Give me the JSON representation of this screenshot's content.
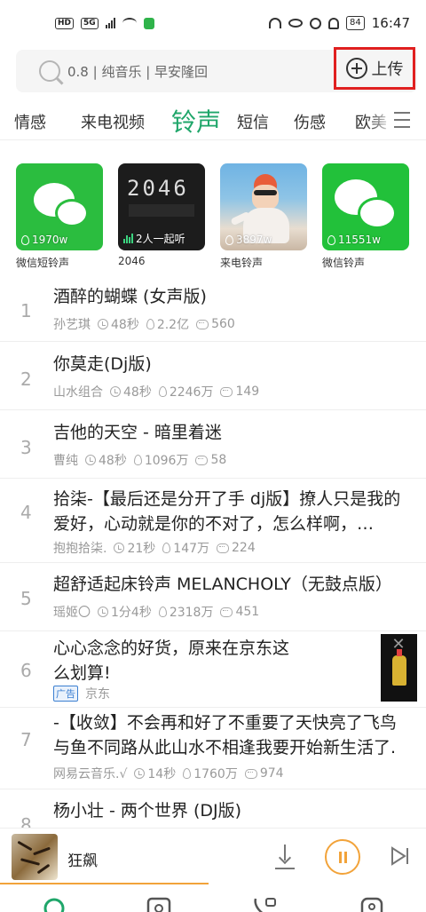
{
  "status_bar": {
    "left_chips": [
      "HD",
      "5G"
    ],
    "wifi_chip": "",
    "battery": "84",
    "time": "16:47"
  },
  "search": {
    "placeholder": "0.8 | 纯音乐 | 早安隆回",
    "upload_label": "上传"
  },
  "tabs": [
    {
      "label": "情感",
      "active": false
    },
    {
      "label": "来电视频",
      "active": false
    },
    {
      "label": "铃声",
      "active": true
    },
    {
      "label": "短信",
      "active": false
    },
    {
      "label": "伤感",
      "active": false
    },
    {
      "label": "欧美",
      "active": false
    }
  ],
  "cards": [
    {
      "label": "微信短铃声",
      "count": "1970w"
    },
    {
      "label": "2046",
      "count": "2人一起听",
      "image_text": "2046"
    },
    {
      "label": "来电铃声",
      "count": "3897w"
    },
    {
      "label": "微信铃声",
      "count": "11551w"
    }
  ],
  "songs": [
    {
      "rank": "1",
      "title": "酒醉的蝴蝶 (女声版)",
      "artist": "孙艺琪",
      "duration": "48秒",
      "plays": "2.2亿",
      "comments": "560"
    },
    {
      "rank": "2",
      "title": "你莫走(Dj版)",
      "artist": "山水组合",
      "duration": "48秒",
      "plays": "2246万",
      "comments": "149"
    },
    {
      "rank": "3",
      "title": "吉他的天空 - 暗里着迷",
      "artist": "曹纯",
      "duration": "48秒",
      "plays": "1096万",
      "comments": "58"
    },
    {
      "rank": "4",
      "title": "拾柒-【最后还是分开了手 dj版】撩人只是我的爱好，心动就是你的不对了，怎么样啊，…",
      "artist": "抱抱拾柒.",
      "duration": "21秒",
      "plays": "147万",
      "comments": "224"
    },
    {
      "rank": "5",
      "title": "超舒适起床铃声 MELANCHOLY（无鼓点版）",
      "artist": "瑶姬〇",
      "duration": "1分4秒",
      "plays": "2318万",
      "comments": "451"
    },
    {
      "rank": "6",
      "title": "心心念念的好货，原来在京东这么划算!",
      "ad_badge": "广告",
      "advertiser": "京东"
    },
    {
      "rank": "7",
      "title": "-【收敛】不会再和好了不重要了天快亮了飞鸟与鱼不同路从此山水不相逢我要开始新生活了.",
      "artist": "网易云音乐.√",
      "duration": "14秒",
      "plays": "1760万",
      "comments": "974"
    },
    {
      "rank": "8",
      "title": "杨小壮 - 两个世界 (DJ版)"
    }
  ],
  "player": {
    "title": "狂飙",
    "progress": 0.49
  },
  "colors": {
    "accent_green": "#1fa66a",
    "player_orange": "#f2a33a",
    "highlight_red": "#e02020"
  }
}
